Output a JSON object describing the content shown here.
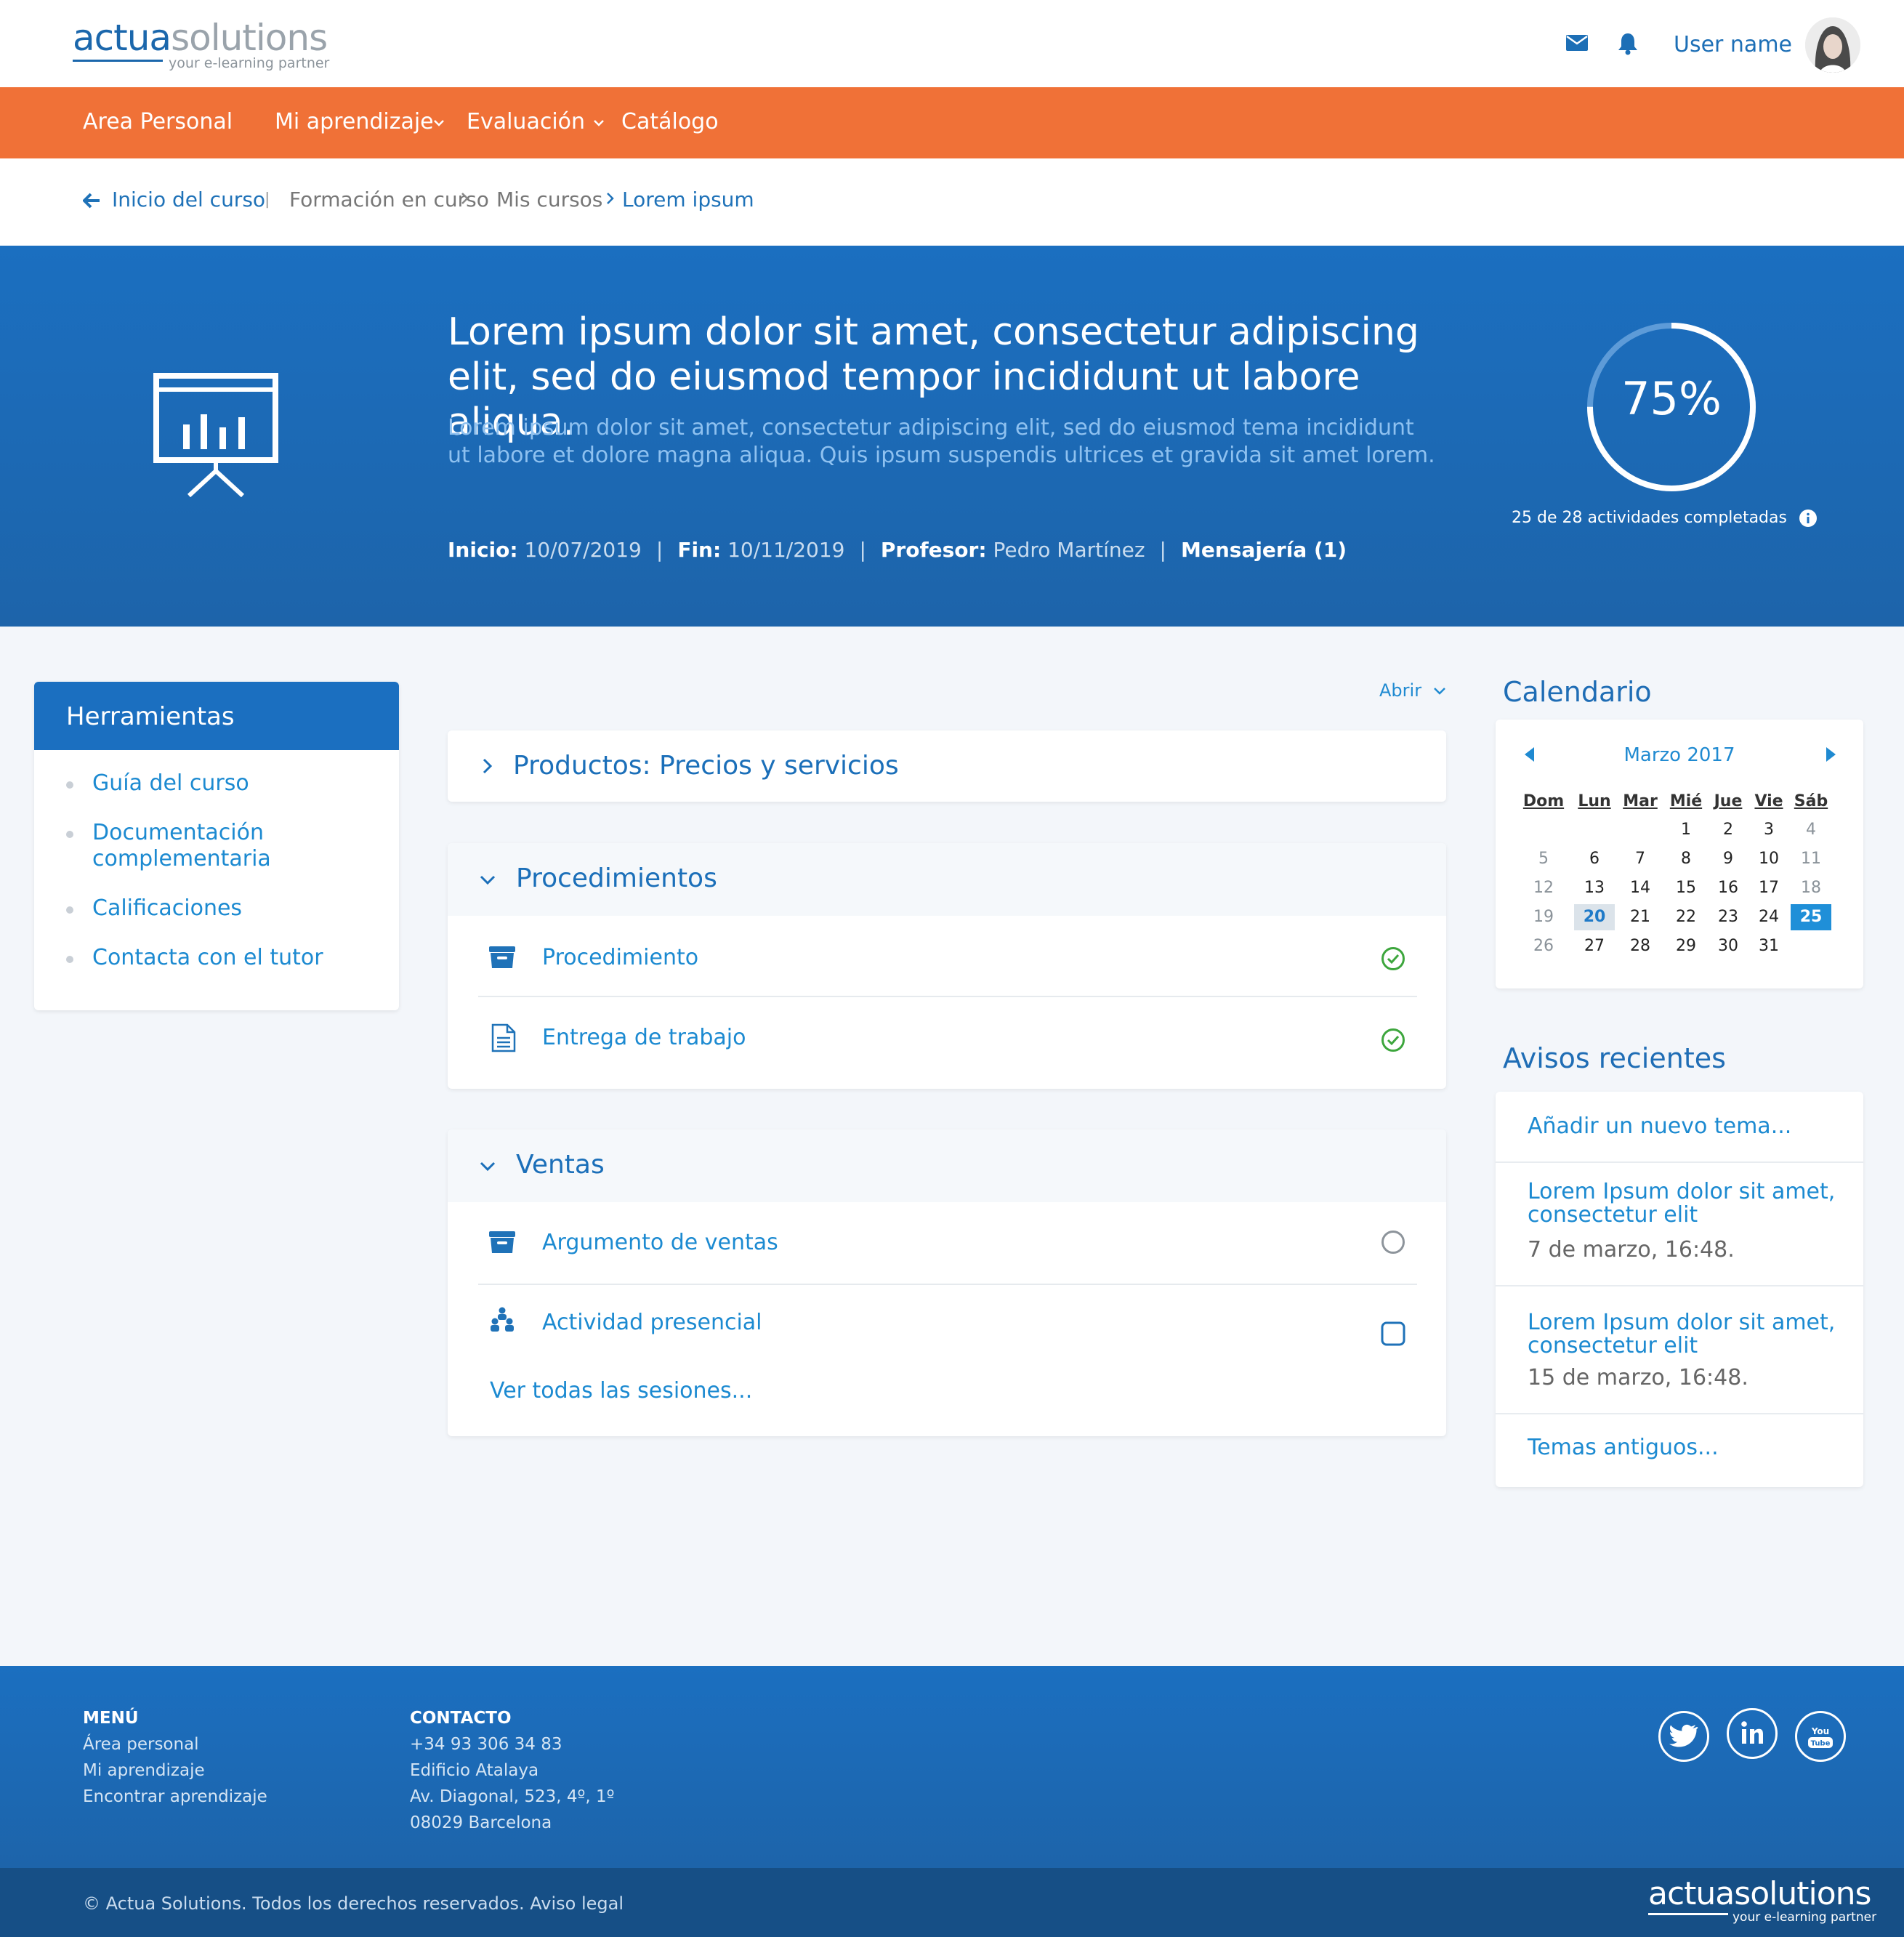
{
  "brand": {
    "name_a": "actua",
    "name_b": "solutions",
    "tagline": "your e-learning partner"
  },
  "header": {
    "username": "User name"
  },
  "nav": [
    "Area Personal",
    "Mi aprendizaje",
    "Evaluación",
    "Catálogo"
  ],
  "breadcrumb": {
    "back": "Inicio del curso",
    "sep": "|",
    "items": [
      "Formación en curso",
      "Mis cursos",
      "Lorem ipsum"
    ]
  },
  "course": {
    "title": "Lorem ipsum dolor sit amet, consectetur adipiscing elit, sed do eiusmod tempor incididunt ut labore aliqua.",
    "subtitle": "Lorem ipsum dolor sit amet, consectetur adipiscing elit, sed do eiusmod tema incididunt ut labore et dolore magna aliqua. Quis ipsum suspendis ultrices et gravida sit amet lorem.",
    "start_label": "Inicio:",
    "start": "10/07/2019",
    "end_label": "Fin:",
    "end": "10/11/2019",
    "teacher_label": "Profesor:",
    "teacher": "Pedro Martínez",
    "messages": "Mensajería (1)",
    "progress_pct": 75,
    "progress_label": "75%",
    "progress_text": "25 de 28 actividades completadas"
  },
  "tools": {
    "title": "Herramientas",
    "items": [
      "Guía del curso",
      "Documentación complementaria",
      "Calificaciones",
      "Contacta con el tutor"
    ]
  },
  "modules": {
    "toggle": "Abrir",
    "collapsed": "Productos: Precios y servicios",
    "procedimientos": {
      "title": "Procedimientos",
      "rows": [
        "Procedimiento",
        "Entrega de trabajo"
      ]
    },
    "ventas": {
      "title": "Ventas",
      "rows": [
        "Argumento de ventas",
        "Actividad presencial"
      ],
      "more": "Ver todas las sesiones..."
    }
  },
  "calendar": {
    "title": "Calendario",
    "month": "Marzo 2017",
    "weekdays": [
      "Dom",
      "Lun",
      "Mar",
      "Mié",
      "Jue",
      "Vie",
      "Sáb"
    ],
    "first_weekday": 3,
    "days": 31,
    "highlighted": 20,
    "today": 25
  },
  "news": {
    "title": "Avisos recientes",
    "add": "Añadir un nuevo tema...",
    "items": [
      {
        "text": "Lorem Ipsum dolor sit amet, consectetur elit",
        "date": "7 de marzo, 16:48."
      },
      {
        "text": "Lorem Ipsum dolor sit amet, consectetur elit",
        "date": "15 de marzo, 16:48."
      }
    ],
    "old": "Temas antiguos..."
  },
  "footer": {
    "menu_title": "MENÚ",
    "menu": [
      "Área personal",
      "Mi aprendizaje",
      "Encontrar aprendizaje"
    ],
    "contact_title": "CONTACTO",
    "contact": [
      "+34 93 306 34 83",
      "Edificio Atalaya",
      "Av. Diagonal, 523, 4º, 1º",
      "08029 Barcelona"
    ],
    "social": [
      "twitter-icon",
      "linkedin-icon",
      "youtube-icon"
    ],
    "copyright": "© Actua Solutions. Todos los derechos reservados. Aviso legal"
  },
  "colors": {
    "primary": "#1b6fc0",
    "accent": "#f07137",
    "link": "#1c8ad1",
    "success": "#3da63d"
  }
}
